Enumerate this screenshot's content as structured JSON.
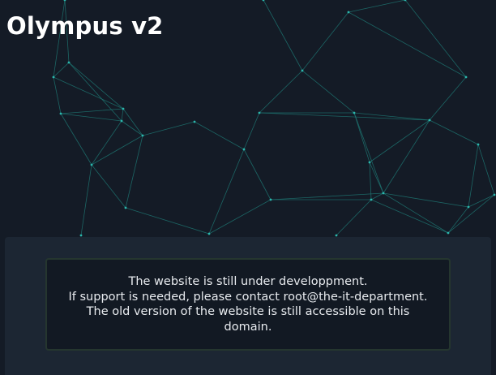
{
  "header": {
    "title": "Olympus v2"
  },
  "notice": {
    "lines": [
      "The website is still under developpment.",
      "If support is needed, please contact root@the-it-department.",
      "The old version of the website is still accessible on this",
      "domain."
    ]
  },
  "colors": {
    "background": "#141b26",
    "panel": "#1c2633",
    "notice_box": "#121923",
    "notice_border": "#25362f",
    "network_lines": "#1f7f7a",
    "network_nodes": "#2bb7ad",
    "title_text": "#ffffff",
    "notice_text": "#e8ebef"
  }
}
